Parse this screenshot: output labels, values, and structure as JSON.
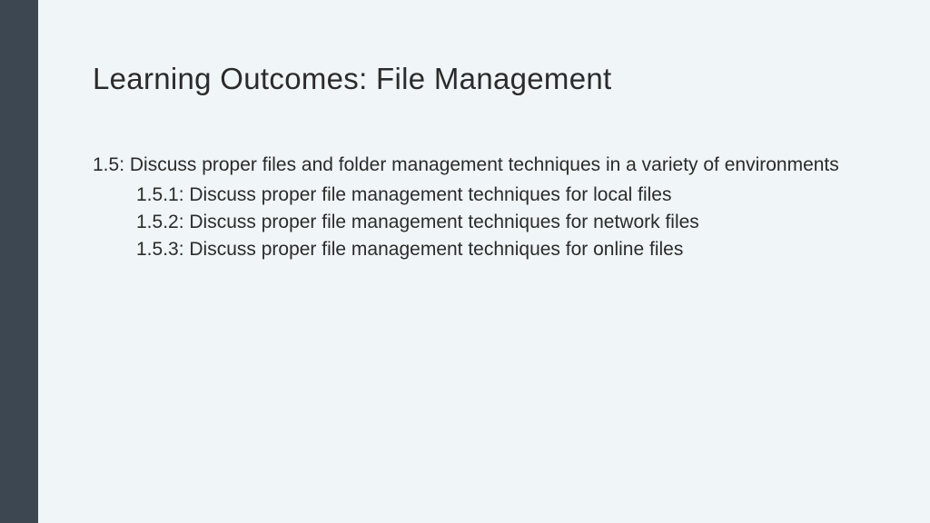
{
  "title": "Learning Outcomes: File Management",
  "mainItem": "1.5: Discuss proper files and folder management techniques in a variety of environments",
  "subItems": [
    "1.5.1: Discuss proper file management techniques for local files",
    "1.5.2: Discuss proper file management techniques for network files",
    "1.5.3: Discuss proper file management techniques for online files"
  ]
}
